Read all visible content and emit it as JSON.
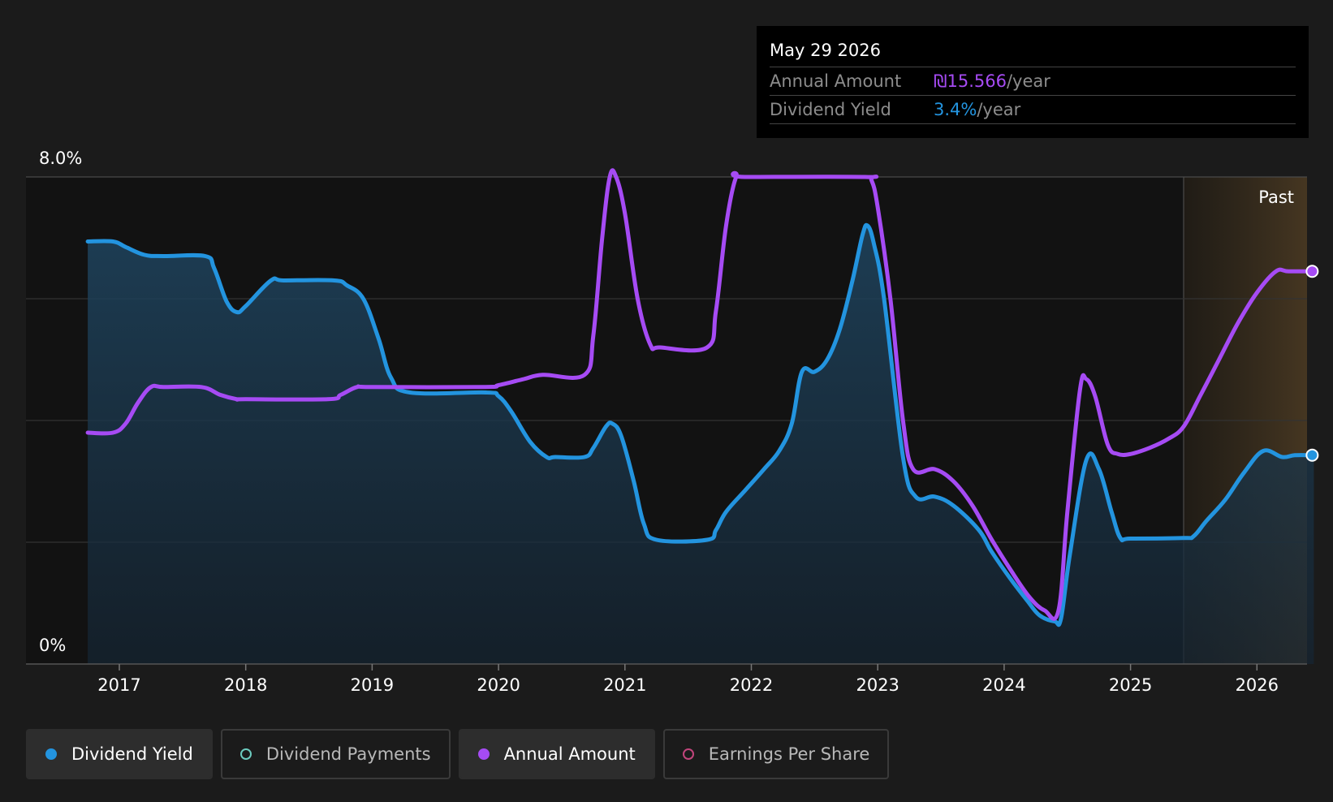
{
  "tooltip": {
    "date": "May 29 2026",
    "rows": [
      {
        "label": "Annual Amount",
        "value": "₪15.566",
        "unit": "/year",
        "color": "#a64bf4"
      },
      {
        "label": "Dividend Yield",
        "value": "3.4%",
        "unit": "/year",
        "color": "#2394df"
      }
    ]
  },
  "legend": [
    {
      "label": "Dividend Yield",
      "color": "#2394df",
      "filled": true,
      "active": true
    },
    {
      "label": "Dividend Payments",
      "color": "#6ccbbf",
      "filled": false,
      "active": false
    },
    {
      "label": "Annual Amount",
      "color": "#a64bf4",
      "filled": true,
      "active": true
    },
    {
      "label": "Earnings Per Share",
      "color": "#c2457c",
      "filled": false,
      "active": false
    }
  ],
  "chart_data": {
    "type": "line",
    "y_ticks": [
      "8.0%",
      "0%"
    ],
    "ylim": [
      0,
      8
    ],
    "xlim": [
      2016.34,
      2026.45
    ],
    "x_ticks": [
      2017,
      2018,
      2019,
      2020,
      2021,
      2022,
      2023,
      2024,
      2025,
      2026
    ],
    "forecast_label": "Past",
    "forecast_start": 2025.42,
    "grid": true,
    "series": [
      {
        "name": "Dividend Yield",
        "color": "#2394df",
        "area": true,
        "points": [
          [
            2016.75,
            6.94
          ],
          [
            2016.95,
            6.94
          ],
          [
            2017.05,
            6.85
          ],
          [
            2017.2,
            6.72
          ],
          [
            2017.35,
            6.7
          ],
          [
            2017.68,
            6.7
          ],
          [
            2017.75,
            6.5
          ],
          [
            2017.85,
            5.95
          ],
          [
            2017.93,
            5.78
          ],
          [
            2018.0,
            5.88
          ],
          [
            2018.2,
            6.3
          ],
          [
            2018.3,
            6.3
          ],
          [
            2018.7,
            6.3
          ],
          [
            2018.8,
            6.22
          ],
          [
            2018.93,
            6.0
          ],
          [
            2019.05,
            5.35
          ],
          [
            2019.15,
            4.7
          ],
          [
            2019.3,
            4.46
          ],
          [
            2019.9,
            4.46
          ],
          [
            2020.0,
            4.4
          ],
          [
            2020.1,
            4.15
          ],
          [
            2020.25,
            3.65
          ],
          [
            2020.38,
            3.4
          ],
          [
            2020.45,
            3.4
          ],
          [
            2020.68,
            3.4
          ],
          [
            2020.75,
            3.55
          ],
          [
            2020.85,
            3.9
          ],
          [
            2020.9,
            3.95
          ],
          [
            2020.97,
            3.75
          ],
          [
            2021.07,
            3.0
          ],
          [
            2021.15,
            2.3
          ],
          [
            2021.25,
            2.04
          ],
          [
            2021.65,
            2.04
          ],
          [
            2021.72,
            2.2
          ],
          [
            2021.8,
            2.5
          ],
          [
            2021.95,
            2.85
          ],
          [
            2022.1,
            3.2
          ],
          [
            2022.22,
            3.5
          ],
          [
            2022.32,
            3.95
          ],
          [
            2022.4,
            4.8
          ],
          [
            2022.5,
            4.8
          ],
          [
            2022.6,
            5.0
          ],
          [
            2022.7,
            5.5
          ],
          [
            2022.8,
            6.3
          ],
          [
            2022.88,
            7.05
          ],
          [
            2022.92,
            7.2
          ],
          [
            2022.97,
            6.9
          ],
          [
            2023.05,
            6.0
          ],
          [
            2023.2,
            3.4
          ],
          [
            2023.3,
            2.75
          ],
          [
            2023.45,
            2.75
          ],
          [
            2023.6,
            2.6
          ],
          [
            2023.8,
            2.2
          ],
          [
            2023.9,
            1.85
          ],
          [
            2024.05,
            1.4
          ],
          [
            2024.18,
            1.05
          ],
          [
            2024.28,
            0.8
          ],
          [
            2024.4,
            0.7
          ],
          [
            2024.45,
            0.75
          ],
          [
            2024.52,
            1.8
          ],
          [
            2024.65,
            3.35
          ],
          [
            2024.75,
            3.2
          ],
          [
            2024.85,
            2.5
          ],
          [
            2024.92,
            2.07
          ],
          [
            2025.0,
            2.06
          ],
          [
            2025.42,
            2.07
          ],
          [
            2025.5,
            2.1
          ],
          [
            2025.6,
            2.35
          ],
          [
            2025.75,
            2.7
          ],
          [
            2025.9,
            3.15
          ],
          [
            2026.05,
            3.5
          ],
          [
            2026.2,
            3.4
          ],
          [
            2026.3,
            3.43
          ],
          [
            2026.45,
            3.43
          ]
        ]
      },
      {
        "name": "Annual Amount",
        "color": "#a64bf4",
        "area": false,
        "points": [
          [
            2016.75,
            3.8
          ],
          [
            2016.95,
            3.8
          ],
          [
            2017.05,
            3.95
          ],
          [
            2017.15,
            4.3
          ],
          [
            2017.25,
            4.55
          ],
          [
            2017.35,
            4.55
          ],
          [
            2017.65,
            4.55
          ],
          [
            2017.8,
            4.42
          ],
          [
            2017.93,
            4.35
          ],
          [
            2018.0,
            4.35
          ],
          [
            2018.65,
            4.35
          ],
          [
            2018.75,
            4.42
          ],
          [
            2018.88,
            4.55
          ],
          [
            2019.0,
            4.55
          ],
          [
            2019.88,
            4.55
          ],
          [
            2020.0,
            4.58
          ],
          [
            2020.2,
            4.68
          ],
          [
            2020.35,
            4.75
          ],
          [
            2020.68,
            4.75
          ],
          [
            2020.75,
            5.4
          ],
          [
            2020.82,
            7.0
          ],
          [
            2020.88,
            8.0
          ],
          [
            2020.93,
            8.0
          ],
          [
            2021.0,
            7.4
          ],
          [
            2021.1,
            6.0
          ],
          [
            2021.2,
            5.25
          ],
          [
            2021.28,
            5.2
          ],
          [
            2021.65,
            5.2
          ],
          [
            2021.72,
            5.8
          ],
          [
            2021.8,
            7.2
          ],
          [
            2021.88,
            8.0
          ],
          [
            2021.95,
            8.0
          ],
          [
            2022.9,
            8.0
          ],
          [
            2022.95,
            7.95
          ],
          [
            2023.0,
            7.5
          ],
          [
            2023.1,
            6.0
          ],
          [
            2023.2,
            4.0
          ],
          [
            2023.28,
            3.2
          ],
          [
            2023.45,
            3.2
          ],
          [
            2023.6,
            3.0
          ],
          [
            2023.75,
            2.6
          ],
          [
            2023.9,
            2.05
          ],
          [
            2024.05,
            1.55
          ],
          [
            2024.2,
            1.1
          ],
          [
            2024.32,
            0.88
          ],
          [
            2024.43,
            0.88
          ],
          [
            2024.5,
            2.5
          ],
          [
            2024.6,
            4.5
          ],
          [
            2024.65,
            4.68
          ],
          [
            2024.72,
            4.4
          ],
          [
            2024.82,
            3.6
          ],
          [
            2024.9,
            3.45
          ],
          [
            2025.0,
            3.45
          ],
          [
            2025.15,
            3.55
          ],
          [
            2025.3,
            3.7
          ],
          [
            2025.42,
            3.9
          ],
          [
            2025.55,
            4.4
          ],
          [
            2025.7,
            5.0
          ],
          [
            2025.85,
            5.6
          ],
          [
            2026.0,
            6.1
          ],
          [
            2026.15,
            6.45
          ],
          [
            2026.25,
            6.45
          ],
          [
            2026.45,
            6.45
          ]
        ]
      }
    ]
  }
}
